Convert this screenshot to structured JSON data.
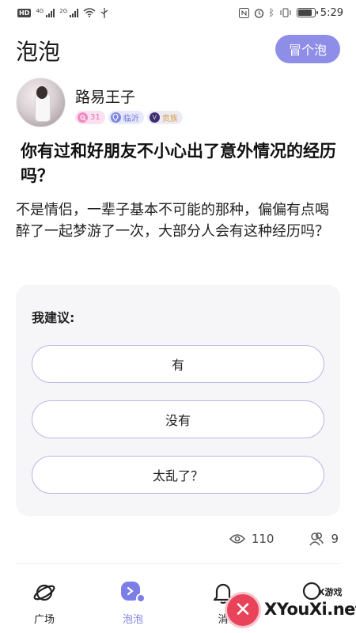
{
  "status_bar": {
    "time": "5:29",
    "hd_badge": "HD",
    "signal1_tag": "4G",
    "signal2_tag": "2G",
    "battery_level": 0.85,
    "icons": [
      "hd-icon",
      "signal-icon",
      "wifi-icon",
      "usb-icon",
      "nfc-icon",
      "alarm-icon",
      "bluetooth-icon",
      "vibrate-icon",
      "battery-icon"
    ]
  },
  "header": {
    "title": "泡泡",
    "post_button": "冒个泡"
  },
  "author": {
    "name": "路易王子",
    "level": "31",
    "location": "临沂",
    "vip": "贵族",
    "vip_icon": "V"
  },
  "question": {
    "title": "你有过和好朋友不小心出了意外情况的经历吗？",
    "body": "  不是情侣，一辈子基本不可能的那种，偏偏有点喝醉了一起梦游了一次，大部分人会有这种经历吗？"
  },
  "suggestion": {
    "label": "我建议:",
    "options": [
      "有",
      "没有",
      "太乱了？"
    ]
  },
  "stats": {
    "views": "110",
    "participants": "9"
  },
  "nav": {
    "items": [
      {
        "label": "广场",
        "icon": "planet-icon"
      },
      {
        "label": "泡泡",
        "icon": "bubble-icon",
        "active": true
      },
      {
        "label": "消",
        "icon": "bell-icon"
      },
      {
        "label": "",
        "icon": "profile-icon"
      }
    ]
  },
  "watermark": {
    "text": "XYouXi.net",
    "small": "X游戏",
    "badge": "✕"
  },
  "colors": {
    "accent": "#8e8ee8",
    "option_border": "#b6b6e8",
    "card_bg": "#f6f6f9"
  }
}
